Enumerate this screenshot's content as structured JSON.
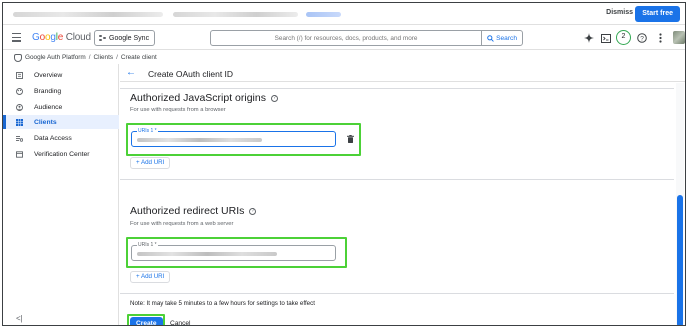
{
  "banner": {
    "dismiss": "Dismiss",
    "start_free": "Start free"
  },
  "topbar": {
    "logo": "Google Cloud",
    "project": "Google Sync",
    "search_placeholder": "Search (/) for resources, docs, products, and more",
    "search_button": "Search",
    "notifications_count": "2"
  },
  "breadcrumb": [
    "Google Auth Platform",
    "Clients",
    "Create client"
  ],
  "sidebar": {
    "items": [
      {
        "label": "Overview",
        "icon": "overview-icon"
      },
      {
        "label": "Branding",
        "icon": "branding-icon"
      },
      {
        "label": "Audience",
        "icon": "audience-icon"
      },
      {
        "label": "Clients",
        "icon": "clients-icon",
        "active": true
      },
      {
        "label": "Data Access",
        "icon": "data-access-icon"
      },
      {
        "label": "Verification Center",
        "icon": "verification-icon"
      }
    ]
  },
  "page": {
    "title": "Create OAuth client ID",
    "js_origins": {
      "heading": "Authorized JavaScript origins",
      "subtitle": "For use with requests from a browser",
      "field_label": "URIs 1 *",
      "add_button": "+ Add URI"
    },
    "redirect_uris": {
      "heading": "Authorized redirect URIs",
      "subtitle": "For use with requests from a web server",
      "field_label": "URIs 1 *",
      "add_button": "+ Add URI"
    },
    "note": "Note: It may take 5 minutes to a few hours for settings to take effect",
    "create_button": "Create",
    "cancel_button": "Cancel"
  },
  "colors": {
    "accent": "#1a73e8",
    "highlight": "#4cd137"
  }
}
